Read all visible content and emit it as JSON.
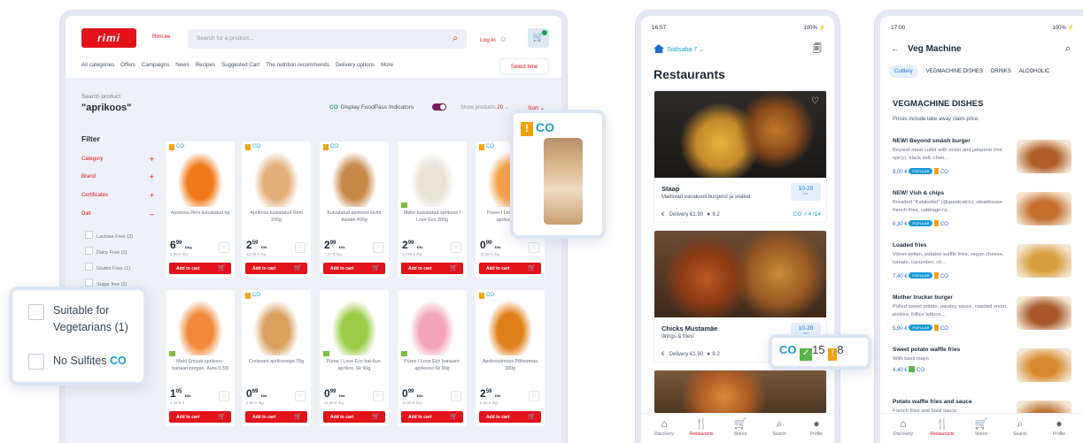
{
  "desktop": {
    "logo": "rimi",
    "rimi_ee": "Rimi.ee",
    "search_placeholder": "Search for a product...",
    "login": "Log in",
    "nav": [
      "All categories",
      "Offers",
      "Campaigns",
      "News",
      "Recipes",
      "Suggested Cart",
      "The nutrition recommends",
      "Delivery options",
      "More"
    ],
    "select_time": "Select time",
    "search_label": "Search product",
    "search_query": "\"aprikoos\"",
    "foodpass": "Display FoodPass Indicators",
    "show_products": "Show products",
    "show_count": "20",
    "sort": "Sort",
    "filter_title": "Filter",
    "filters": [
      "Category",
      "Brand",
      "Certificates",
      "Diet"
    ],
    "diet_options": [
      "Lactose Free (2)",
      "Dairy Free (1)",
      "Gluten Free (1)",
      "Sugar free (1)"
    ],
    "add_to_cart": "Add to cart",
    "products": [
      {
        "name": "Aprikoos Rimi kuivatatud kg",
        "price_main": "6",
        "price_cents": "99",
        "unit": "€/kg",
        "per": "6,99 € /kg",
        "color": "#f07a1a"
      },
      {
        "name": "Aprikoos kuivatatud Rimi 200g",
        "price_main": "2",
        "price_cents": "59",
        "unit": "€/tk",
        "per": "12,95 € /kg",
        "color": "#e3b07a"
      },
      {
        "name": "Kuivatatud aprikoos kivita Awake 400g",
        "price_main": "2",
        "price_cents": "99",
        "unit": "€/tk",
        "per": "7,47 € /kg",
        "color": "#c8884a"
      },
      {
        "name": "Mahe kuivatatud aprikoos I Love Eco 200g",
        "price_main": "2",
        "price_cents": "99",
        "unit": "€/tk",
        "per": "14,95 € /kg",
        "color": "#e8e4d8"
      },
      {
        "name": "Püree I Love Eco bat-aprikoos 90g",
        "price_main": "0",
        "price_cents": "99",
        "unit": "€/tk",
        "per": "11,00 € /kg",
        "color": "#f5a24a"
      },
      {
        "name": "Mahl Smuuti aprikoos-banaan-porgan. Aura 0,33l",
        "price_main": "1",
        "price_cents": "05",
        "unit": "€/tk",
        "per": "3,18 € /l",
        "color": "#f08a3a"
      },
      {
        "name": "Croissant aprikoosiga 70g",
        "price_main": "0",
        "price_cents": "69",
        "unit": "€/tk",
        "per": "9,86 € /kg",
        "color": "#d9a060"
      },
      {
        "name": "Püree I Love Eco bat-õun-aprikoo. 6k 90g",
        "price_main": "0",
        "price_cents": "99",
        "unit": "€/tk",
        "per": "11,00 € /kg",
        "color": "#9ccc48"
      },
      {
        "name": "Püree I Love Eco banaani-aprikoosi 6k 90g",
        "price_main": "0",
        "price_cents": "99",
        "unit": "€/tk",
        "per": "11,00 € /kg",
        "color": "#f3a4b8"
      },
      {
        "name": "Aprikoosimoos Põltsamaa 380g",
        "price_main": "2",
        "price_cents": "59",
        "unit": "€/tk",
        "per": "6,82 € /kg",
        "color": "#e0801a"
      }
    ]
  },
  "diet_popup": {
    "opt1": "Suitable for Vegetarians (1)",
    "opt2": "No Sulfites",
    "oo": "CO"
  },
  "zoom_badge": {
    "warn": "!",
    "oo": "CO"
  },
  "indicator_popup": {
    "oo": "CO",
    "check": "✓",
    "green_count": "15",
    "warn": "!",
    "yellow_count": "8"
  },
  "phone1": {
    "time": "16:57",
    "battery": "100%",
    "location": "Siidisaba 7",
    "title": "Restaurants",
    "restaurants": [
      {
        "name": "Staap",
        "desc": "Maitsvad vanakooli burgerid ja snäkid",
        "time": "10-20",
        "time_unit": "min",
        "delivery": "Delivery €1.90",
        "rating": "9.2",
        "ind": "CO ✓4 !14"
      },
      {
        "name": "Chicks Mustamäe",
        "desc": "Wings & fries!",
        "time": "10-20",
        "time_unit": "min",
        "delivery": "Delivery €1.90",
        "rating": "9.2",
        "ind": ""
      }
    ],
    "tabs": [
      "Discovery",
      "Restaurants",
      "Stores",
      "Search",
      "Profile"
    ]
  },
  "phone2": {
    "time": "17:00",
    "battery": "100%",
    "title": "Veg Machine",
    "tabs": [
      "Cuttlery",
      "VEGMACHINE DISHES",
      "DRINKS",
      "ALCOHOLIC"
    ],
    "section": "VEGMACHINE DISHES",
    "note": "Prices include take away claim price.",
    "dishes": [
      {
        "name": "NEW! Beyond smäsh burger",
        "desc": "Beyond meat cutlet with onion and jalopeno (not spicy), black salt, chee...",
        "price": "9,00 €",
        "popular": true
      },
      {
        "name": "NEW! Vish & chips",
        "desc": "Breaded \"Kalakotlet\" (@goodcatch), steakhouse french fries, cabbage-ra...",
        "price": "8,30 €",
        "popular": true
      },
      {
        "name": "Loaded fries",
        "desc": "Vöner-seitan, potatoe waffle fries, vegan cheese, tomato, cucumber, cri...",
        "price": "7,40 €",
        "popular": true
      },
      {
        "name": "Mother trucker burger",
        "desc": "Pulled sweet potato, parsley sauce, roasted onion, pickles, frillice lettuce...",
        "price": "5,90 €",
        "popular": true
      },
      {
        "name": "Sweet potato waffle fries",
        "desc": "With basil mayo",
        "price": "4,40 €",
        "popular": false
      },
      {
        "name": "Potato waffle fries and sauce",
        "desc": "French fries and basil sauce",
        "price": "",
        "popular": false
      }
    ],
    "popular_label": "POPULAR",
    "tabs_bottom": [
      "Discovery",
      "Restaurants",
      "Stores",
      "Search",
      "Profile"
    ]
  }
}
